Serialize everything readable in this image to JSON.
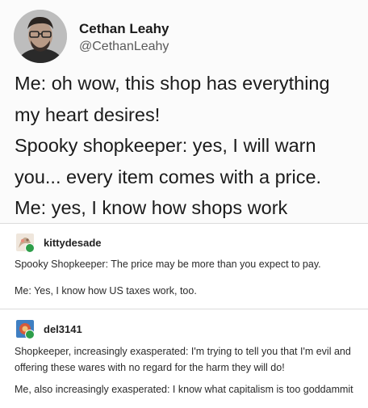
{
  "tweet": {
    "author_name": "Cethan Leahy",
    "author_handle": "@CethanLeahy",
    "lines": [
      "Me: oh wow, this shop has everything",
      "my heart desires!",
      "Spooky shopkeeper: yes, I will warn",
      "you... every item comes with a price.",
      "Me: yes, I know how shops work"
    ]
  },
  "posts": [
    {
      "username": "kittydesade",
      "paragraphs": [
        "Spooky Shopkeeper: The price may be more than you expect to pay.",
        "Me: Yes, I know how US taxes work, too."
      ]
    },
    {
      "username": "del3141",
      "paragraphs": [
        "Shopkeeper, increasingly exasperated: I'm trying to tell you that I'm evil and offering these wares with no regard for the harm they will do!",
        "Me, also increasingly exasperated: I know what capitalism is too goddammit"
      ]
    }
  ],
  "colors": {
    "badge": "#2e9e4a",
    "avatar_kittydesade": "#d8c9b8",
    "avatar_del3141": "#3f7fc2"
  }
}
